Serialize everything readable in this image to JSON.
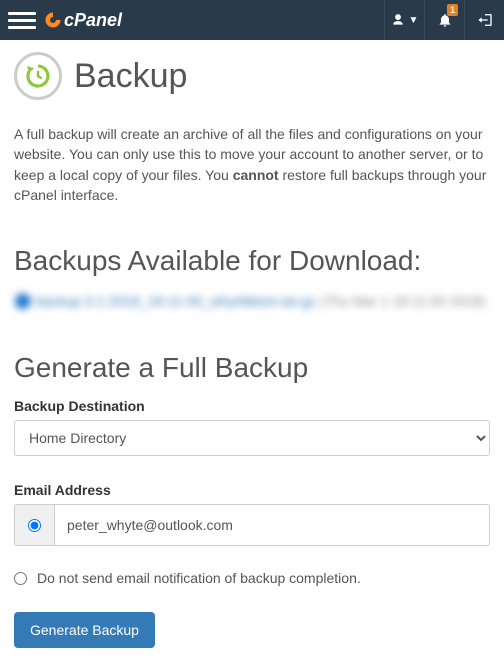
{
  "topbar": {
    "brand": "cPanel",
    "notification_count": "1"
  },
  "page": {
    "title": "Backup",
    "intro_before": "A full backup will create an archive of all the files and configurations on your website. You can only use this to move your account to another server, or to keep a local copy of your files. You ",
    "intro_strong": "cannot",
    "intro_after": " restore full backups through your cPanel interface."
  },
  "downloads": {
    "heading": "Backups Available for Download:",
    "blurred_link": "backup-3.1.2018_18-11-00_whyrtbkem.tar.gz",
    "blurred_meta": "(Thu Mar 1 18:11:00 2018)"
  },
  "generate": {
    "heading": "Generate a Full Backup",
    "destination_label": "Backup Destination",
    "destination_value": "Home Directory",
    "email_label": "Email Address",
    "email_value": "peter_whyte@outlook.com",
    "no_email_label": "Do not send email notification of backup completion.",
    "submit_label": "Generate Backup"
  }
}
